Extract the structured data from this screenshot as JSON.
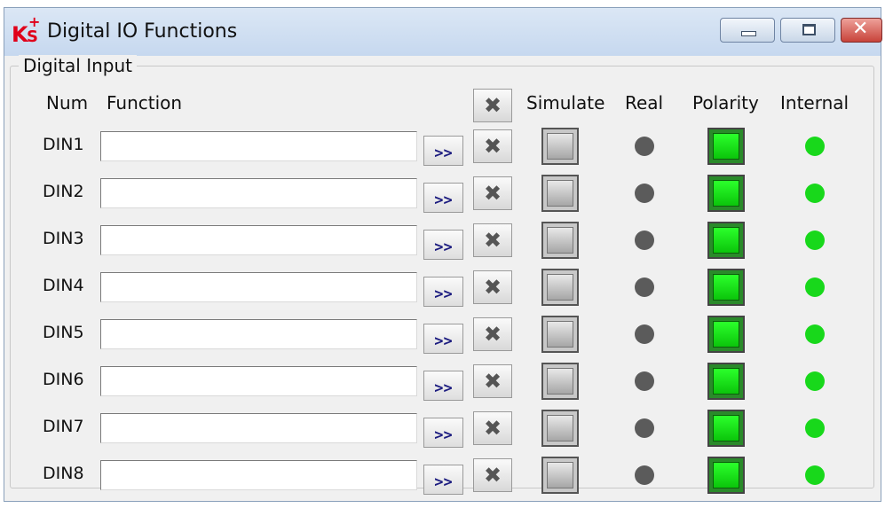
{
  "window": {
    "title": "Digital IO Functions",
    "logo_text": "KS+"
  },
  "titlebar_buttons": {
    "minimize": "minimize",
    "maximize": "maximize",
    "close": "✕"
  },
  "group": {
    "label": "Digital Input"
  },
  "headers": {
    "num": "Num",
    "function": "Function",
    "simulate": "Simulate",
    "real": "Real",
    "polarity": "Polarity",
    "internal": "Internal"
  },
  "clear_all_icon": "✖",
  "rows": [
    {
      "num": "DIN1",
      "function_value": "",
      "arrow_label": ">>",
      "clear_icon": "✖"
    },
    {
      "num": "DIN2",
      "function_value": "",
      "arrow_label": ">>",
      "clear_icon": "✖"
    },
    {
      "num": "DIN3",
      "function_value": "",
      "arrow_label": ">>",
      "clear_icon": "✖"
    },
    {
      "num": "DIN4",
      "function_value": "",
      "arrow_label": ">>",
      "clear_icon": "✖"
    },
    {
      "num": "DIN5",
      "function_value": "",
      "arrow_label": ">>",
      "clear_icon": "✖"
    },
    {
      "num": "DIN6",
      "function_value": "",
      "arrow_label": ">>",
      "clear_icon": "✖"
    },
    {
      "num": "DIN7",
      "function_value": "",
      "arrow_label": ">>",
      "clear_icon": "✖"
    },
    {
      "num": "DIN8",
      "function_value": "",
      "arrow_label": ">>",
      "clear_icon": "✖"
    }
  ],
  "colors": {
    "real_indicator_off": "#5b5b5b",
    "internal_indicator_on": "#18d81b",
    "polarity_on": "#1fe21f",
    "close_button": "#c8433a"
  }
}
